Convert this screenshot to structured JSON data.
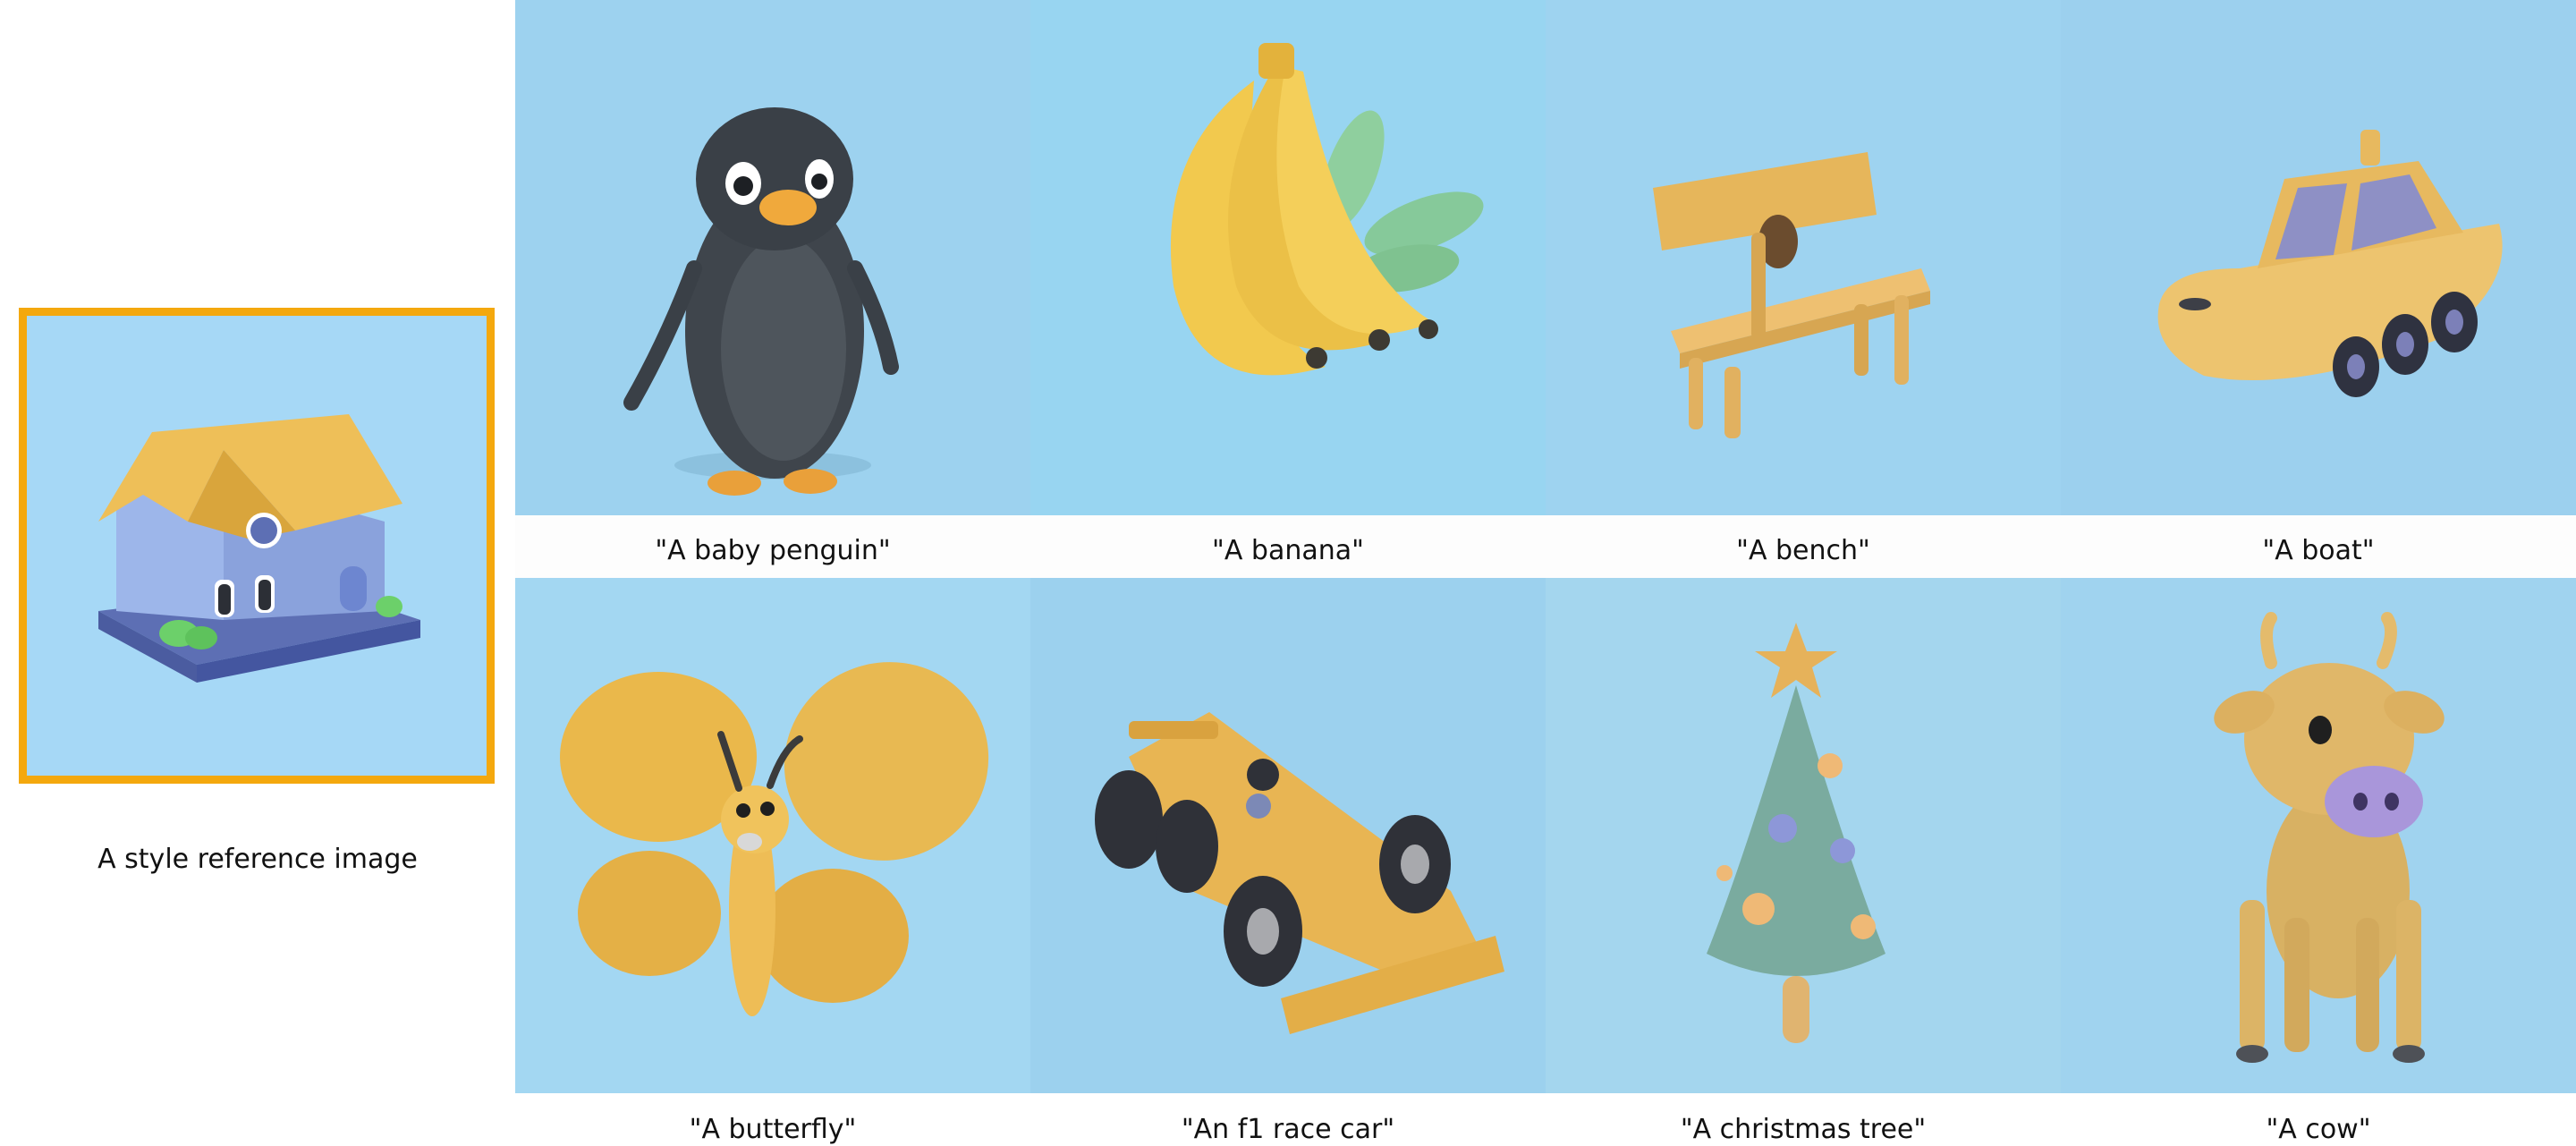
{
  "reference": {
    "caption": "A style reference image"
  },
  "items": [
    {
      "caption": "\"A baby penguin\"",
      "icon": "penguin-icon"
    },
    {
      "caption": "\"A banana\"",
      "icon": "banana-icon"
    },
    {
      "caption": "\"A bench\"",
      "icon": "bench-icon"
    },
    {
      "caption": "\"A boat\"",
      "icon": "boat-icon"
    },
    {
      "caption": "\"A butterfly\"",
      "icon": "butterfly-icon"
    },
    {
      "caption": "\"An f1 race car\"",
      "icon": "race-car-icon"
    },
    {
      "caption": "\"A christmas tree\"",
      "icon": "christmas-tree-icon"
    },
    {
      "caption": "\"A cow\"",
      "icon": "cow-icon"
    }
  ],
  "colors": {
    "frame": "#f4a80e",
    "sky": "#a6d8f6",
    "clay_yellow": "#e9b94e",
    "clay_dark": "#4a4f56",
    "clay_blue": "#8fa6e3"
  }
}
